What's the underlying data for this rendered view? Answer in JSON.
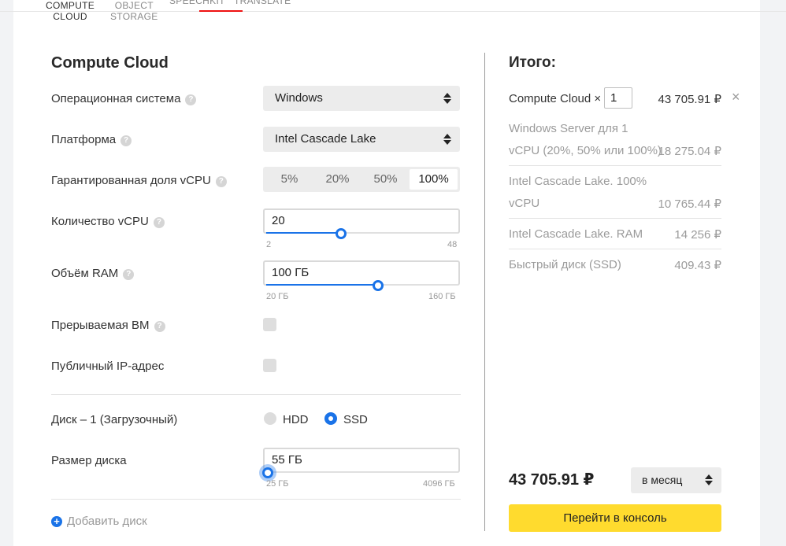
{
  "tabs": [
    {
      "label_line1": "COMPUTE",
      "label_line2": "CLOUD"
    },
    {
      "label_line1": "OBJECT",
      "label_line2": "STORAGE"
    },
    {
      "label_line1": "SPEECHKIT",
      "label_line2": ""
    },
    {
      "label_line1": "TRANSLATE",
      "label_line2": ""
    }
  ],
  "config": {
    "title": "Compute Cloud",
    "os": {
      "label": "Операционная система",
      "value": "Windows"
    },
    "platform": {
      "label": "Платформа",
      "value": "Intel Cascade Lake"
    },
    "vcpu_share": {
      "label": "Гарантированная доля vCPU",
      "options": [
        "5%",
        "20%",
        "50%",
        "100%"
      ],
      "selected": "100%"
    },
    "vcpu_count": {
      "label": "Количество vCPU",
      "value": "20",
      "min": "2",
      "max": "48",
      "fraction": 0.39
    },
    "ram": {
      "label": "Объём RAM",
      "value": "100 ГБ",
      "min": "20 ГБ",
      "max": "160 ГБ",
      "fraction": 0.58
    },
    "preemptible": {
      "label": "Прерываемая ВМ",
      "checked": false
    },
    "public_ip": {
      "label": "Публичный IP-адрес",
      "checked": false
    },
    "disk": {
      "label": "Диск – 1 (Загрузочный)",
      "hdd": "HDD",
      "ssd": "SSD",
      "selected": "SSD"
    },
    "disk_size": {
      "label": "Размер диска",
      "value": "55 ГБ",
      "min": "25 ГБ",
      "max": "4096 ГБ",
      "fraction": 0.01
    },
    "add_disk": "Добавить диск",
    "help_glyph": "?"
  },
  "summary": {
    "title": "Итого:",
    "service": "Compute Cloud ×",
    "quantity": "1",
    "service_price": "43 705.91 ₽",
    "close_glyph": "×",
    "lines": [
      {
        "line1": "Windows Server для 1",
        "line2": "vCPU (20%, 50% или 100%)",
        "price": "18 275.04 ₽"
      },
      {
        "line1": "Intel Cascade Lake. 100%",
        "line2": "vCPU",
        "price": "10 765.44 ₽"
      },
      {
        "line1": "Intel Cascade Lake. RAM",
        "line2": "",
        "price": "14 256 ₽"
      },
      {
        "line1": "Быстрый диск (SSD)",
        "line2": "",
        "price": "409.43 ₽"
      }
    ],
    "total": "43 705.91 ₽",
    "period": "в месяц",
    "cta": "Перейти в консоль"
  },
  "colors": {
    "accent": "#1a73e8",
    "cta": "#ffdb2e",
    "tab_active": "#ee1111"
  }
}
